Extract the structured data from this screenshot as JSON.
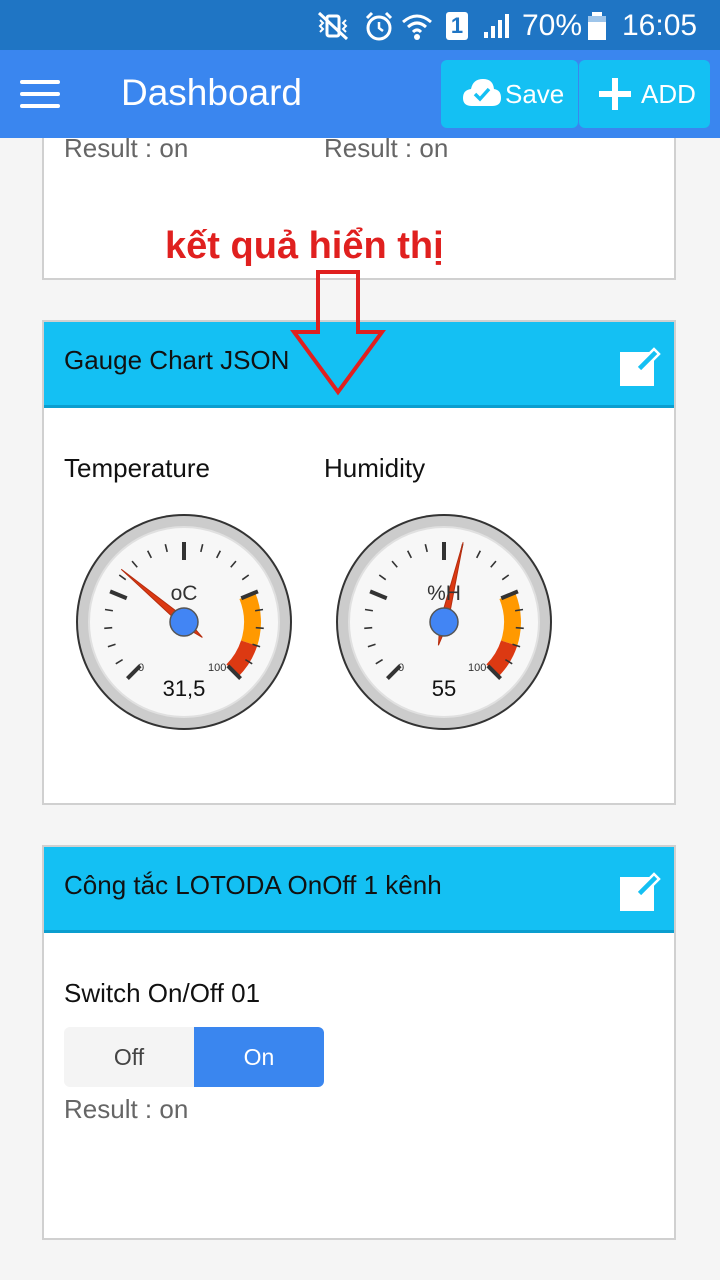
{
  "status_bar": {
    "battery": "70%",
    "time": "16:05",
    "sim_slot": "1",
    "icons": [
      "vibrate-mute-icon",
      "alarm-icon",
      "wifi-icon",
      "sim-1-icon",
      "signal-icon",
      "battery-icon"
    ]
  },
  "app_bar": {
    "title": "Dashboard",
    "save_label": "Save",
    "add_label": "ADD",
    "icons": [
      "menu-icon",
      "cloud-check-icon",
      "plus-icon"
    ]
  },
  "colors": {
    "status_bar": "#1f75c4",
    "app_bar": "#3a86ef",
    "button": "#14c0f3",
    "card_header": "#14c0f3",
    "annotation": "#e0201f",
    "gauge_warning": "#ff9900",
    "gauge_danger": "#dc3912",
    "gauge_needle": "#dc3912",
    "gauge_hub": "#4285f4",
    "switch_active": "#3a86ef"
  },
  "partial_card": {
    "results": [
      "Result : on",
      "Result : on"
    ]
  },
  "annotation": {
    "text": "kết quả hiển thị"
  },
  "gauge_card": {
    "title": "Gauge Chart JSON",
    "gauges": [
      {
        "label": "Temperature",
        "unit": "oC",
        "value": 31.5,
        "display": "31,5",
        "min": 0,
        "max": 100,
        "min_label": "0",
        "max_label": "100",
        "yellow_from": 75,
        "yellow_to": 90,
        "red_from": 90,
        "red_to": 100
      },
      {
        "label": "Humidity",
        "unit": "%H",
        "value": 55,
        "display": "55",
        "min": 0,
        "max": 100,
        "min_label": "0",
        "max_label": "100",
        "yellow_from": 75,
        "yellow_to": 90,
        "red_from": 90,
        "red_to": 100
      }
    ]
  },
  "switch_card": {
    "title": "Công tắc LOTODA OnOff 1 kênh",
    "widget_label": "Switch On/Off 01",
    "off_label": "Off",
    "on_label": "On",
    "state": "on",
    "result": "Result : on"
  }
}
